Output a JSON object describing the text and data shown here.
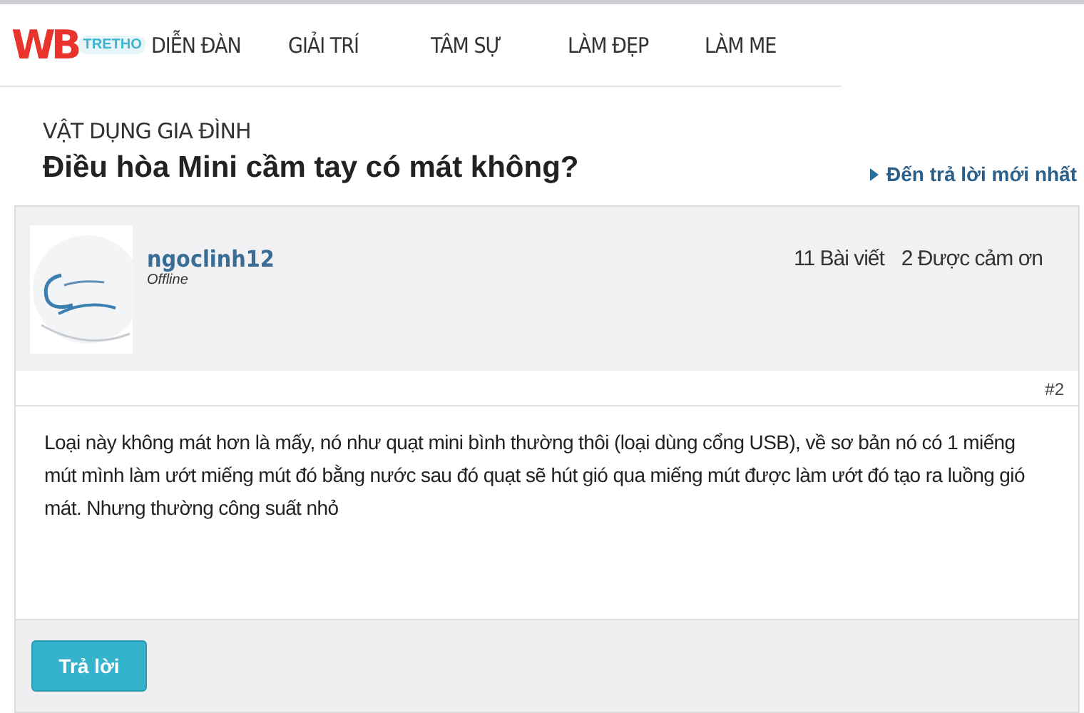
{
  "logo": {
    "letters": "WB",
    "subtitle": "TRETHO"
  },
  "nav": [
    {
      "label": "DIỄN ĐÀN"
    },
    {
      "label": "GIẢI TRÍ"
    },
    {
      "label": "TÂM SỰ"
    },
    {
      "label": "LÀM ĐẸP"
    },
    {
      "label": "LÀM ME"
    }
  ],
  "category": "VẬT DỤNG GIA ĐÌNH",
  "thread_title": "Điều hòa Mini cầm tay có mát không?",
  "latest_reply_link": "Đến trả lời mới nhất",
  "post": {
    "author": "ngoclinh12",
    "status": "Offline",
    "stats": [
      "11 Bài viết",
      "2 Được cảm ơn"
    ],
    "number": "#2",
    "body": "Loại này không mát hơn là mấy, nó như quạt mini bình thường thôi (loại dùng cổng USB), về sơ bản nó có 1 miếng mút mình làm ướt miếng mút đó bằng nước sau đó quạt sẽ hút gió qua miếng mút được làm ướt đó tạo ra luồng gió mát. Nhưng thường công suất nhỏ"
  },
  "reply_button": "Trả lời"
}
